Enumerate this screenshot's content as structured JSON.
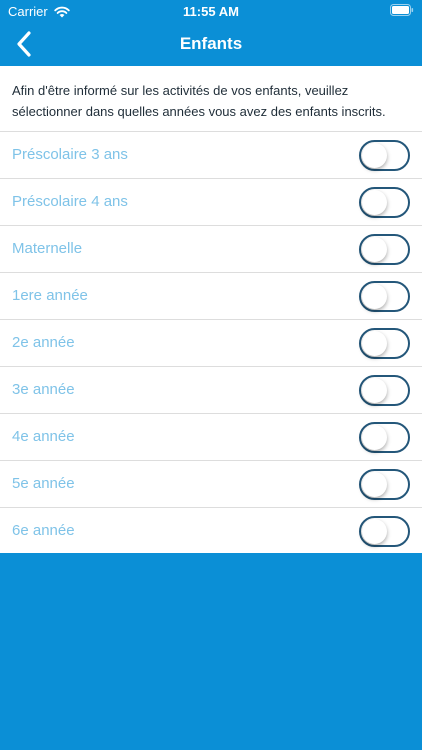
{
  "statusbar": {
    "carrier": "Carrier",
    "time": "11:55 AM"
  },
  "navbar": {
    "title": "Enfants"
  },
  "intro": "Afin d'être informé sur les activités de vos enfants, veuillez sélectionner dans quelles années vous avez des enfants inscrits.",
  "grades": [
    {
      "label": "Préscolaire 3 ans",
      "on": false
    },
    {
      "label": "Préscolaire 4 ans",
      "on": false
    },
    {
      "label": "Maternelle",
      "on": false
    },
    {
      "label": "1ere année",
      "on": false
    },
    {
      "label": "2e année",
      "on": false
    },
    {
      "label": "3e année",
      "on": false
    },
    {
      "label": "4e année",
      "on": false
    },
    {
      "label": "5e année",
      "on": false
    },
    {
      "label": "6e année",
      "on": false
    }
  ],
  "colors": {
    "brand": "#0b8fd6",
    "label": "#7fc3e8",
    "toggle_border": "#24577a"
  }
}
